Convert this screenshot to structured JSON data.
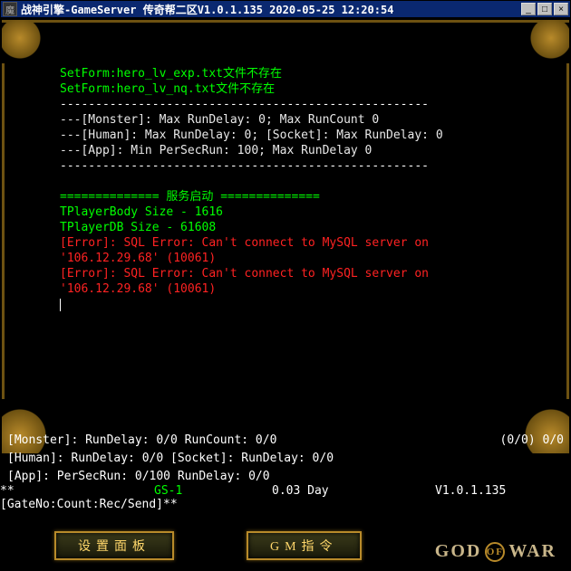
{
  "titlebar": {
    "icon_char": "魔",
    "title": "战神引擎-GameServer 传奇帮二区V1.0.1.135 2020-05-25 12:20:54",
    "minimize": "_",
    "maximize": "□",
    "close": "×"
  },
  "console": {
    "line1": "SetForm:hero_lv_exp.txt文件不存在",
    "line2": "SetForm:hero_lv_nq.txt文件不存在",
    "sep1": "----------------------------------------------------",
    "line3": "---[Monster]: Max RunDelay: 0; Max RunCount 0",
    "line4": "---[Human]: Max RunDelay: 0; [Socket]: Max RunDelay: 0",
    "line5": "---[App]: Min PerSecRun: 100; Max RunDelay 0",
    "sep2": "----------------------------------------------------",
    "line6": "============== 服务启动 ==============",
    "line7": "TPlayerBody Size - 1616",
    "line8": "TPlayerDB Size - 61608",
    "err1a": "[Error]: SQL Error: Can't connect to MySQL server on",
    "err1b": "'106.12.29.68' (10061)",
    "err2a": "[Error]: SQL Error: Can't connect to MySQL server on",
    "err2b": "'106.12.29.68' (10061)"
  },
  "stats": {
    "row1_left": "[Monster]: RunDelay: 0/0 RunCount: 0/0",
    "row1_right": "(0/0) 0/0",
    "row2": "[Human]: RunDelay: 0/0 [Socket]: RunDelay: 0/0",
    "row3": "[App]: PerSecRun: 0/100 RunDelay: 0/0"
  },
  "gate": {
    "label": "**[GateNo:Count:Rec/Send]**",
    "gs": "GS-1",
    "day": "0.03 Day",
    "version": "V1.0.1.135"
  },
  "buttons": {
    "settings": "设置面板",
    "gm": "GM指令"
  },
  "logo": {
    "part1": "GOD",
    "omega": "OF",
    "part2": "WAR"
  }
}
